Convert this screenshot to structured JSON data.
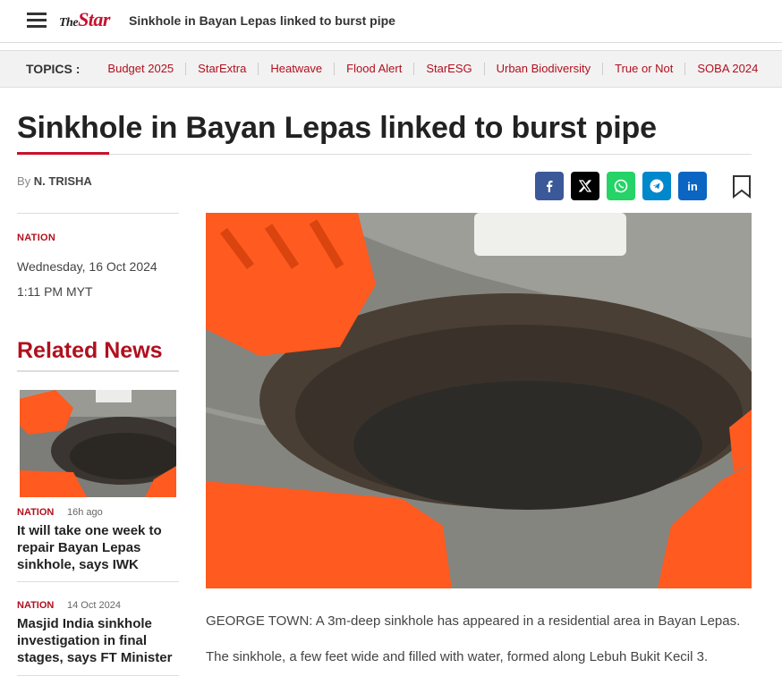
{
  "header": {
    "logo_the": "The",
    "logo_star": "Star",
    "title": "Sinkhole in Bayan Lepas linked to burst pipe"
  },
  "topics": {
    "label": "TOPICS :",
    "items": [
      "Budget 2025",
      "StarExtra",
      "Heatwave",
      "Flood Alert",
      "StarESG",
      "Urban Biodiversity",
      "True or Not",
      "SOBA 2024"
    ]
  },
  "article": {
    "title": "Sinkhole in Bayan Lepas linked to burst pipe",
    "by": "By",
    "author": "N. TRISHA",
    "category": "NATION",
    "date": "Wednesday, 16 Oct 2024",
    "time": "1:11 PM MYT",
    "paragraphs": [
      "GEORGE TOWN: A 3m-deep sinkhole has appeared in a residential area in Bayan Lepas.",
      "The sinkhole, a few feet wide and filled with water, formed along Lebuh Bukit Kecil 3."
    ]
  },
  "share": {
    "icons": [
      "facebook-icon",
      "x-icon",
      "whatsapp-icon",
      "telegram-icon",
      "linkedin-icon"
    ],
    "colors": [
      "#3b5998",
      "#000000",
      "#25d366",
      "#0088cc",
      "#0a66c2"
    ],
    "bookmark_icon": "bookmark-icon"
  },
  "related": {
    "heading": "Related News",
    "items": [
      {
        "category": "NATION",
        "time": "16h ago",
        "title": "It will take one week to repair Bayan Lepas sinkhole, says IWK"
      },
      {
        "category": "NATION",
        "time": "14 Oct 2024",
        "title": "Masjid India sinkhole investigation in final stages, says FT Minister"
      }
    ]
  },
  "colors": {
    "brand": "#c8102e",
    "topic_link": "#b0101e"
  }
}
